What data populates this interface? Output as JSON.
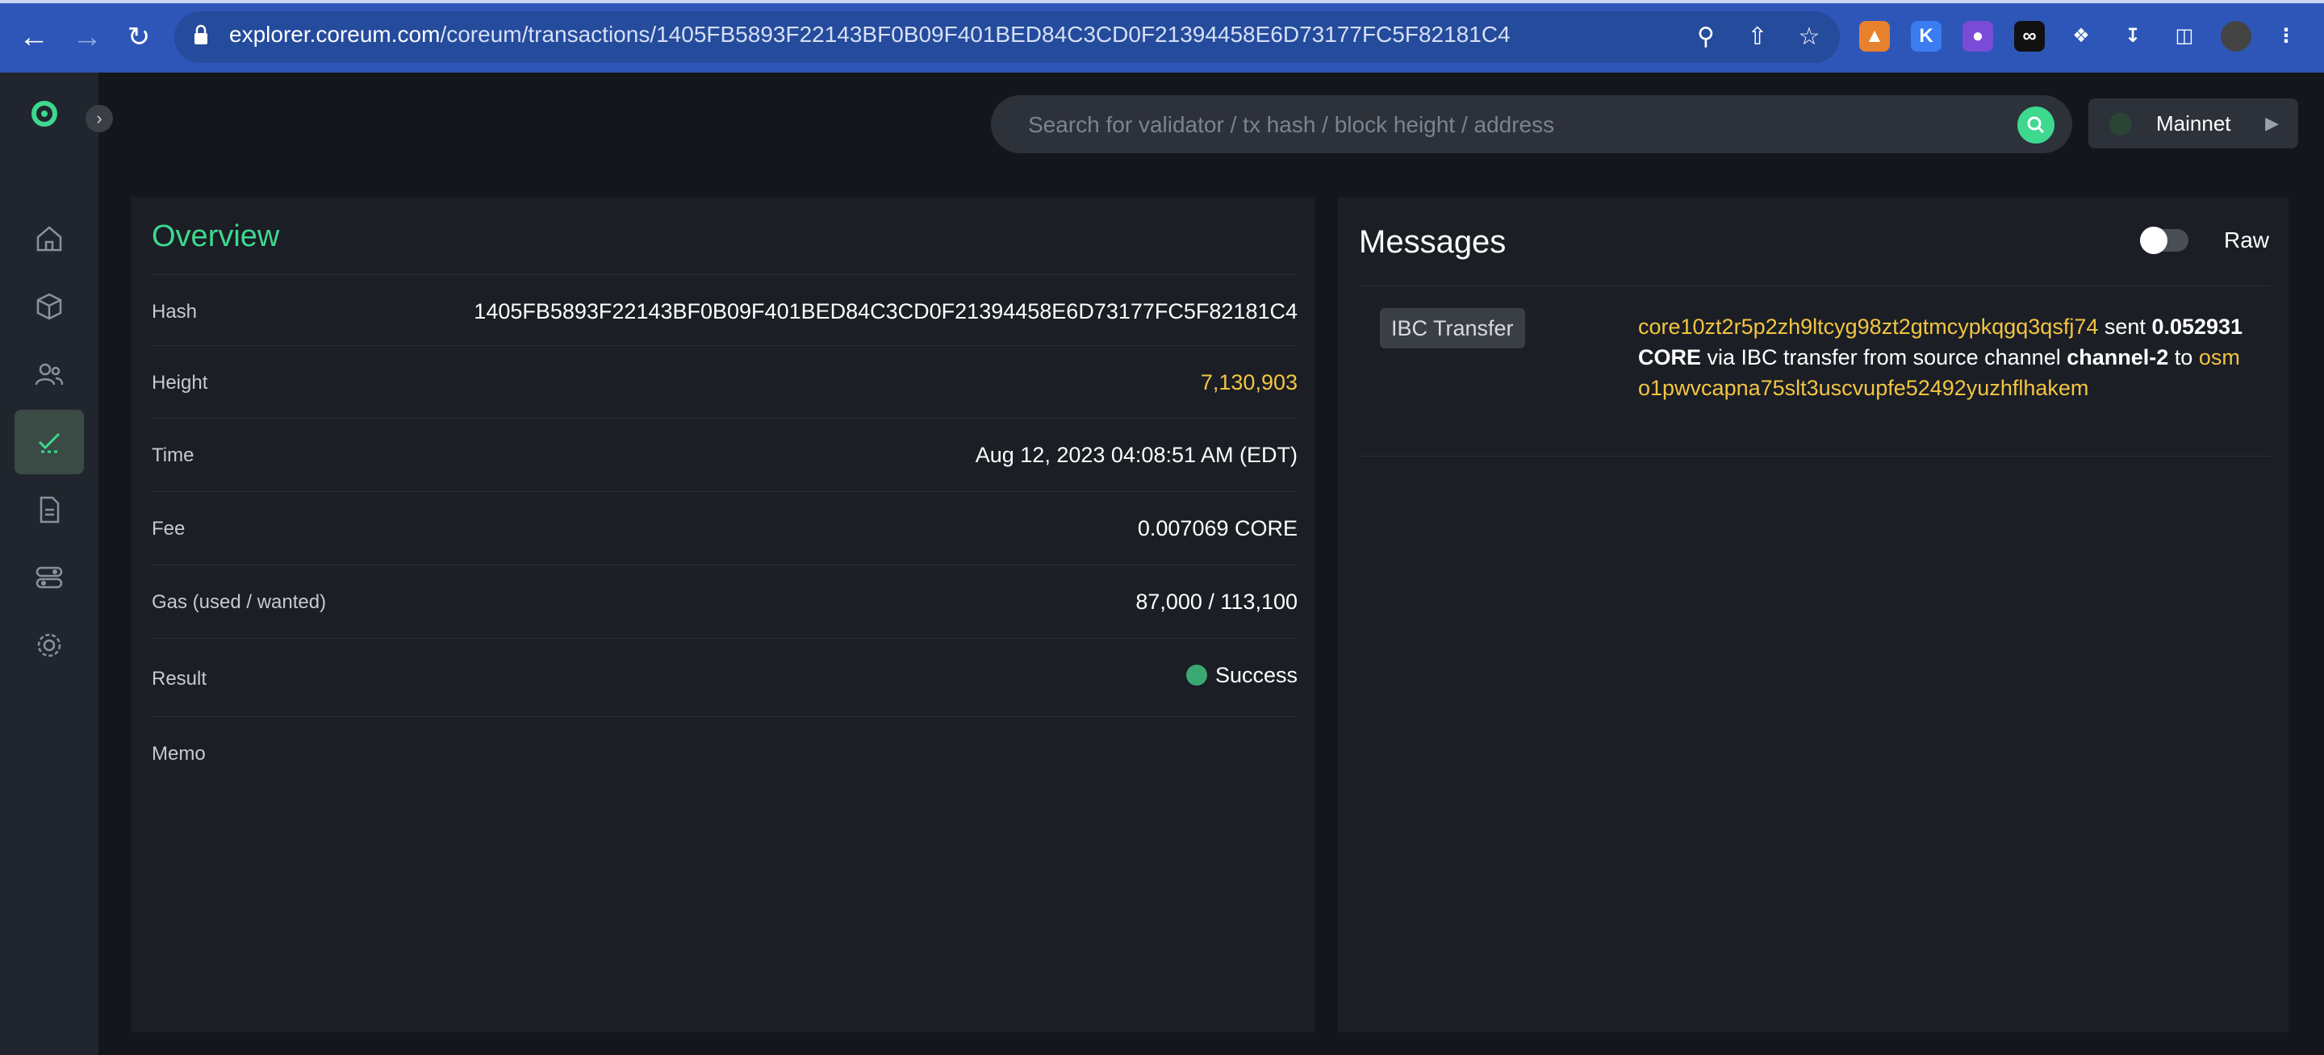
{
  "browser": {
    "url_host": "explorer.coreum.com",
    "url_path": "/coreum/transactions/1405FB5893F22143BF0B09F401BED84C3CD0F21394458E6D73177FC5F82181C4"
  },
  "header": {
    "search_placeholder": "Search for validator / tx hash / block height / address",
    "network": "Mainnet"
  },
  "overview": {
    "title": "Overview",
    "rows": {
      "hash": {
        "label": "Hash",
        "value": "1405FB5893F22143BF0B09F401BED84C3CD0F21394458E6D73177FC5F82181C4"
      },
      "height": {
        "label": "Height",
        "value": "7,130,903"
      },
      "time": {
        "label": "Time",
        "value": "Aug 12, 2023 04:08:51 AM (EDT)"
      },
      "fee": {
        "label": "Fee",
        "value": "0.007069 CORE"
      },
      "gas": {
        "label": "Gas (used / wanted)",
        "value": "87,000 / 113,100"
      },
      "result": {
        "label": "Result",
        "value": "Success"
      },
      "memo": {
        "label": "Memo",
        "value": ""
      }
    }
  },
  "messages": {
    "title": "Messages",
    "raw_label": "Raw",
    "raw_enabled": false,
    "items": [
      {
        "type": "IBC Transfer",
        "sender": "core10zt2r5p2zh9ltcyg98zt2gtmcypkqgq3qsfj74",
        "word_sent": "sent",
        "amount": "0.052931 CORE",
        "middle_text": "via IBC transfer from source channel",
        "channel": "channel-2",
        "word_to": "to",
        "receiver": "osmo1pwvcapna75slt3uscvupfe52492yuzhflhakem"
      }
    ]
  },
  "colors": {
    "accent_green": "#3ed88f",
    "link_yellow": "#f3c542",
    "chrome_blue": "#2d56b8"
  }
}
